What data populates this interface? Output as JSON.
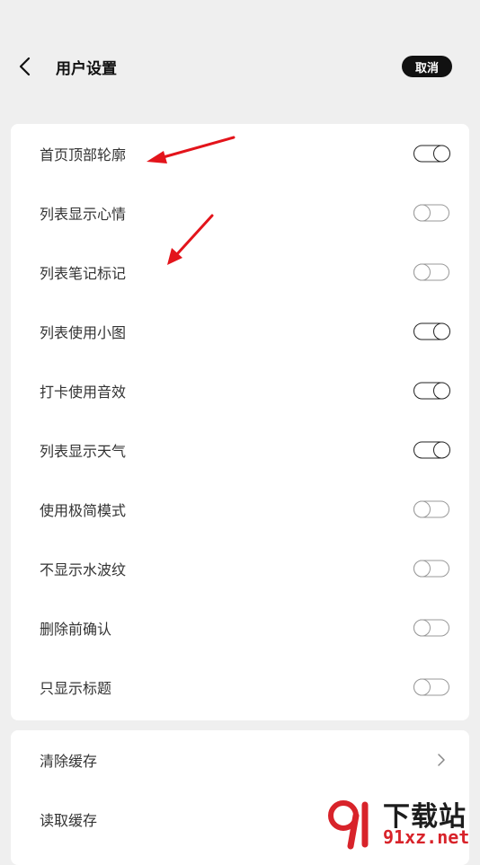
{
  "header": {
    "title": "用户设置",
    "cancel_label": "取消"
  },
  "settings": [
    {
      "label": "首页顶部轮廓",
      "on": true
    },
    {
      "label": "列表显示心情",
      "on": false
    },
    {
      "label": "列表笔记标记",
      "on": false
    },
    {
      "label": "列表使用小图",
      "on": true
    },
    {
      "label": "打卡使用音效",
      "on": true
    },
    {
      "label": "列表显示天气",
      "on": true
    },
    {
      "label": "使用极简模式",
      "on": false
    },
    {
      "label": "不显示水波纹",
      "on": false
    },
    {
      "label": "删除前确认",
      "on": false
    },
    {
      "label": "只显示标题",
      "on": false
    }
  ],
  "cache": [
    {
      "label": "清除缓存"
    },
    {
      "label": "读取缓存"
    }
  ],
  "watermark": {
    "text_main": "下载站",
    "text_url": "91xz.net"
  },
  "colors": {
    "background": "#efefef",
    "card": "#ffffff",
    "annotation_arrow": "#e3141b",
    "watermark_red": "#d8232a"
  }
}
